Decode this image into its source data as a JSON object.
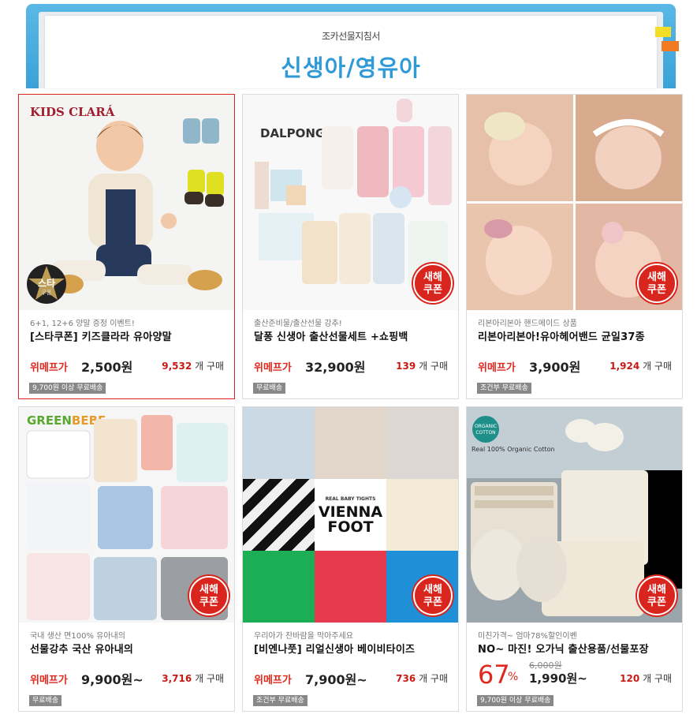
{
  "banner": {
    "subtitle": "조카선물지침서",
    "title": "신생아/영유아"
  },
  "colors": {
    "accent_red": "#e0281d",
    "banner_blue": "#3aa2d8",
    "badge_gray": "#888888"
  },
  "products": [
    {
      "brand": "KIDS CLARÁ",
      "badge": {
        "top": "스타",
        "bottom": "쿠폰"
      },
      "desc": "6+1, 12+6 양말 증정 이벤트!",
      "name": "[스타쿠폰] 키즈클라라 유아양말",
      "price_label": "위메프가",
      "price": "2,500원",
      "sales_count": "9,532",
      "sales_suffix": "개 구매",
      "shipping": "9,700원 이상 무료배송"
    },
    {
      "brand": "DALPONG",
      "coupon": {
        "line1": "새해",
        "line2": "쿠폰"
      },
      "desc": "출산준비물/출산선물 강추!",
      "name": "달퐁 신생아 출산선물세트 +쇼핑백",
      "price_label": "위메프가",
      "price": "32,900원",
      "sales_count": "139",
      "sales_suffix": "개 구매",
      "shipping": "무료배송"
    },
    {
      "coupon": {
        "line1": "새해",
        "line2": "쿠폰"
      },
      "desc": "리본아리본아 핸드메이드 상품",
      "name": "리본아리본아!유아헤어밴드 균일37종",
      "price_label": "위메프가",
      "price": "3,900원",
      "sales_count": "1,924",
      "sales_suffix": "개 구매",
      "shipping": "조건부 무료배송"
    },
    {
      "brand_left": "GREEN",
      "brand_right": "BEBE",
      "coupon": {
        "line1": "새해",
        "line2": "쿠폰"
      },
      "desc": "국내 생산 면100% 유아내의",
      "name": "선물강추 국산 유아내의",
      "price_label": "위메프가",
      "price": "9,900원~",
      "sales_count": "3,716",
      "sales_suffix": "개 구매",
      "shipping": "무료배송"
    },
    {
      "center_small": "REAL BABY TIGHTS",
      "center_line1": "VIENNA",
      "center_line2": "FOOT",
      "coupon": {
        "line1": "새해",
        "line2": "쿠폰"
      },
      "desc": "우리아가 찬바람을 막아주세요",
      "name": "[비엔나풋] 리얼신생아 베이비타이즈",
      "price_label": "위메프가",
      "price": "7,900원~",
      "sales_count": "736",
      "sales_suffix": "개 구매",
      "shipping": "조건부 무료배송"
    },
    {
      "logo_text": "ORGANIC COTTON",
      "tagline": "Real 100% Organic Cotton",
      "coupon": {
        "line1": "새해",
        "line2": "쿠폰"
      },
      "desc": "미친가격~ 엄마78%할인이벤",
      "name": "NO~ 마진! 오가닉 출산용품/선물포장",
      "discount": "67",
      "discount_unit": "%",
      "original_price": "6,000원",
      "price": "1,990원~",
      "sales_count": "120",
      "sales_suffix": "개 구매",
      "shipping": "9,700원 이상 무료배송"
    }
  ]
}
